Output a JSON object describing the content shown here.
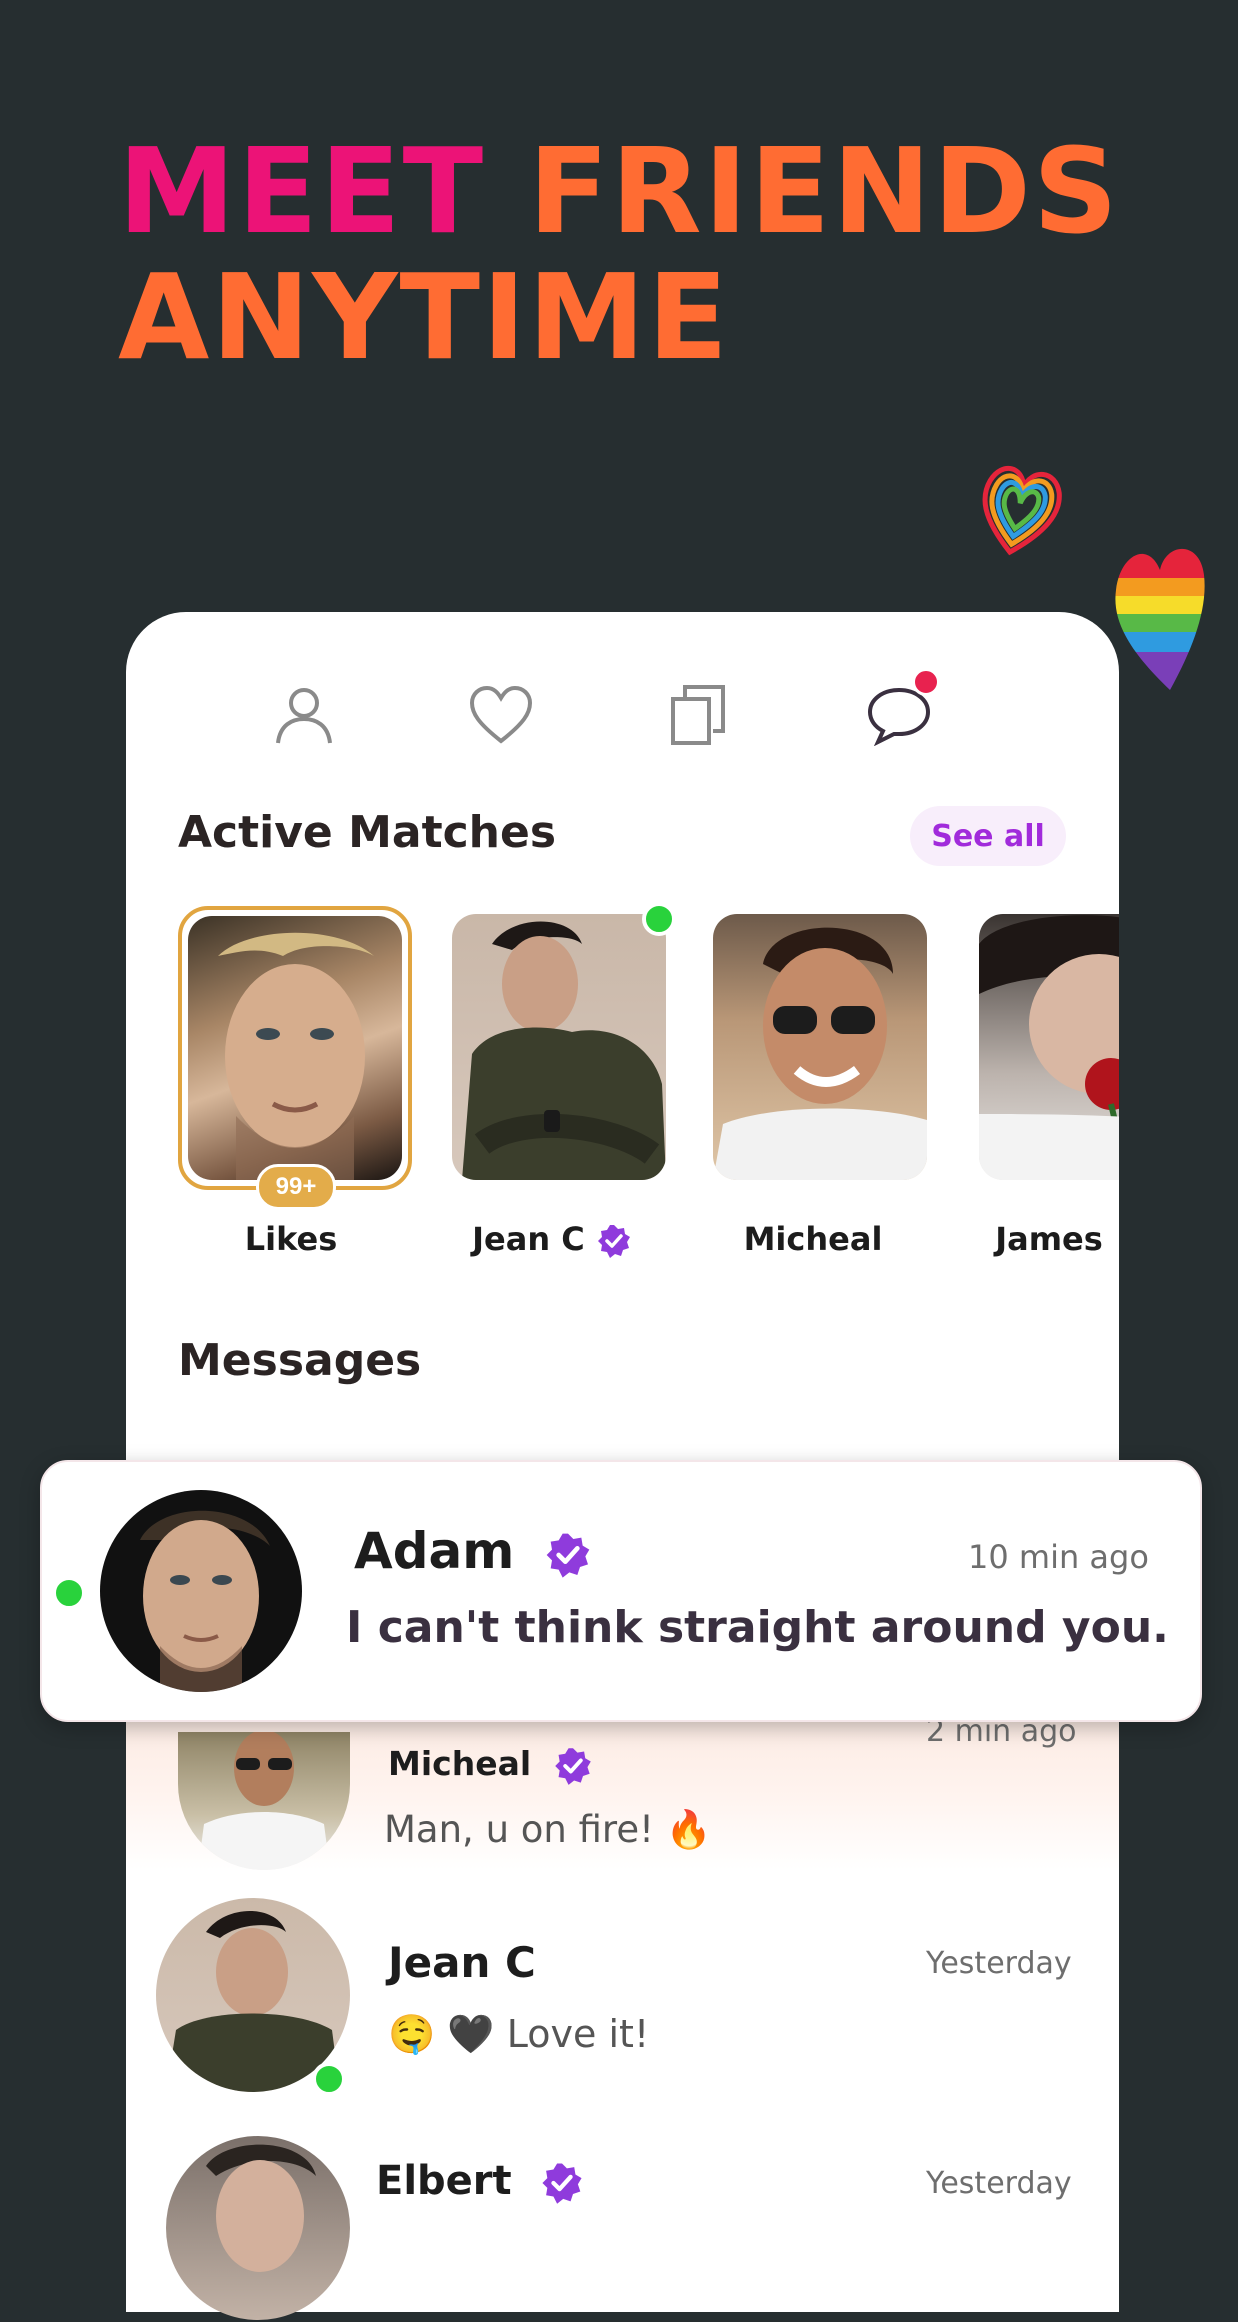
{
  "headline": {
    "line1_word1": "MEET",
    "line1_word2": "FRIENDS",
    "line2": "ANYTIME"
  },
  "colors": {
    "background": "#262e30",
    "pink": "#ec1377",
    "orange": "#ff6c33",
    "verified": "#8f3bdc",
    "online": "#29d23c"
  },
  "tabs": [
    {
      "icon": "person-icon"
    },
    {
      "icon": "heart-icon"
    },
    {
      "icon": "cards-icon"
    },
    {
      "icon": "chat-bubble-icon",
      "notification": true
    }
  ],
  "active_matches": {
    "title": "Active Matches",
    "see_all": "See all",
    "items": [
      {
        "name": "Likes",
        "badge": "99+"
      },
      {
        "name": "Jean C",
        "verified": true,
        "online": true
      },
      {
        "name": "Micheal"
      },
      {
        "name": "James"
      }
    ]
  },
  "messages": {
    "title": "Messages",
    "featured": {
      "name": "Adam",
      "verified": true,
      "time": "10 min ago",
      "text": "I can't think straight around you.",
      "online": true
    },
    "items": [
      {
        "name": "Micheal",
        "verified": true,
        "time": "2 min ago",
        "text": "Man, u on fire! 🔥"
      },
      {
        "name": "Jean C",
        "verified": false,
        "time": "Yesterday",
        "text": "🤤 🖤 Love it!",
        "online": true
      },
      {
        "name": "Elbert",
        "verified": true,
        "time": "Yesterday",
        "text": ""
      }
    ]
  }
}
